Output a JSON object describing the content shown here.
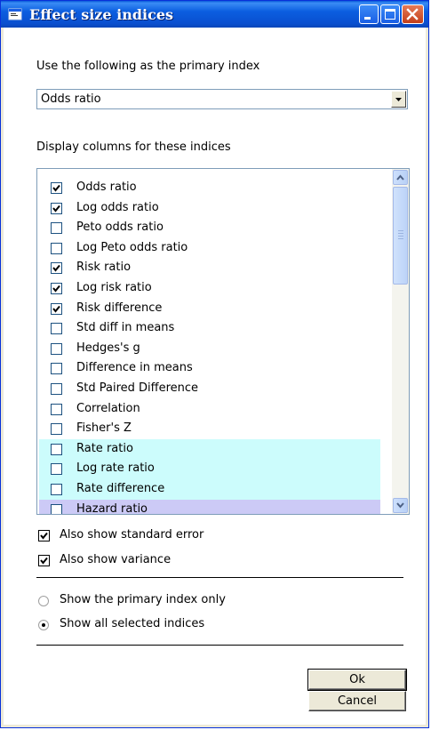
{
  "window": {
    "title": "Effect size indices",
    "controls": [
      "minimize-icon",
      "maximize-icon",
      "close-icon"
    ]
  },
  "primary_index": {
    "label": "Use the following as the primary index",
    "selected": "Odds ratio"
  },
  "display_columns": {
    "label": "Display columns for these indices",
    "items": [
      {
        "label": "Odds ratio",
        "checked": true
      },
      {
        "label": "Log odds ratio",
        "checked": true
      },
      {
        "label": "Peto odds ratio",
        "checked": false
      },
      {
        "label": "Log Peto odds ratio",
        "checked": false
      },
      {
        "label": "Risk ratio",
        "checked": true
      },
      {
        "label": "Log risk ratio",
        "checked": true
      },
      {
        "label": "Risk difference",
        "checked": true
      },
      {
        "label": "Std diff in means",
        "checked": false
      },
      {
        "label": "Hedges's g",
        "checked": false
      },
      {
        "label": "Difference in means",
        "checked": false
      },
      {
        "label": "Std Paired Difference",
        "checked": false
      },
      {
        "label": "Correlation",
        "checked": false
      },
      {
        "label": "Fisher's Z",
        "checked": false
      },
      {
        "label": "Rate ratio",
        "checked": false,
        "highlight": "cyan"
      },
      {
        "label": "Log rate ratio",
        "checked": false,
        "highlight": "cyan"
      },
      {
        "label": "Rate difference",
        "checked": false,
        "highlight": "cyan"
      },
      {
        "label": "Hazard ratio",
        "checked": false,
        "highlight": "lavender"
      }
    ]
  },
  "options": {
    "std_error": {
      "label": "Also show standard error",
      "checked": true
    },
    "variance": {
      "label": "Also show variance",
      "checked": true
    }
  },
  "display_mode": {
    "primary_only": {
      "label": "Show the primary index only",
      "selected": false
    },
    "all_selected": {
      "label": "Show all selected indices",
      "selected": true
    }
  },
  "buttons": {
    "ok": "Ok",
    "cancel": "Cancel"
  },
  "colors": {
    "titlebar": "#0a5bd9",
    "highlight_cyan": "#ccfcfc",
    "highlight_lavender": "#cccaf6"
  }
}
